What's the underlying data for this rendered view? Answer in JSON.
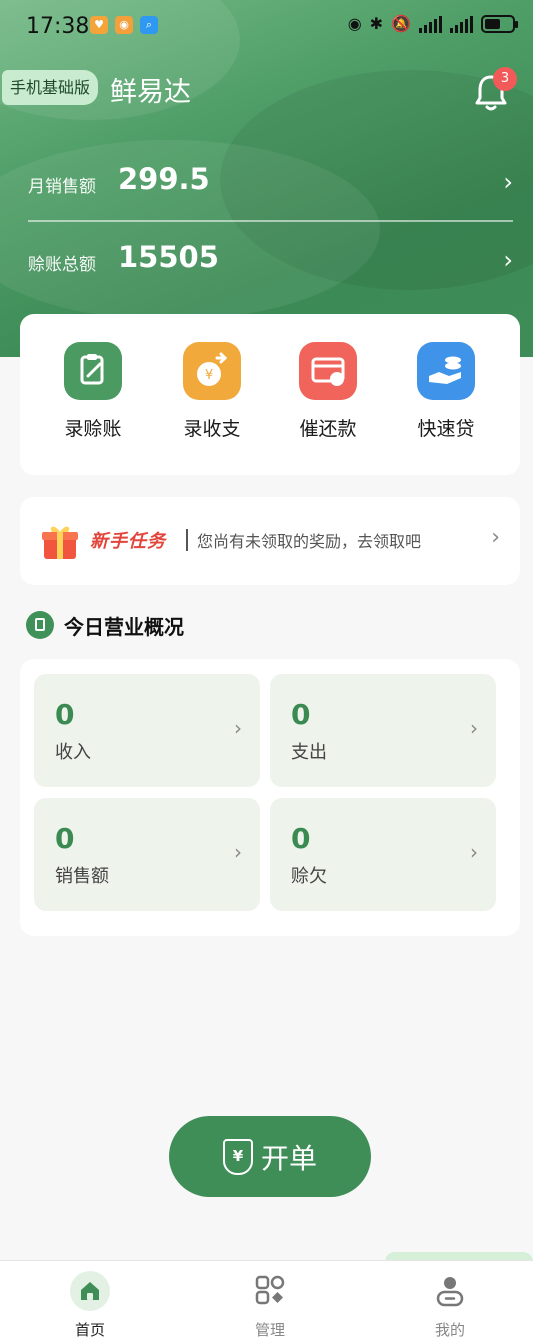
{
  "status_bar": {
    "time": "17:38"
  },
  "header": {
    "plan_badge": "手机基础版",
    "shop_name": "鲜易达",
    "notification_count": "3"
  },
  "stats": [
    {
      "label": "月销售额",
      "value": "299.5"
    },
    {
      "label": "赊账总额",
      "value": "15505"
    }
  ],
  "quick_actions": [
    {
      "label": "录赊账",
      "icon": "clipboard-edit-icon",
      "color": "#4a9a62"
    },
    {
      "label": "录收支",
      "icon": "coin-exchange-icon",
      "color": "#f2a93b"
    },
    {
      "label": "催还款",
      "icon": "card-reminder-icon",
      "color": "#f0645c"
    },
    {
      "label": "快速贷",
      "icon": "hand-coins-icon",
      "color": "#3f93e8"
    }
  ],
  "task_banner": {
    "title": "新手任务",
    "description": "您尚有未领取的奖励，去领取吧"
  },
  "overview": {
    "title": "今日营业概况",
    "tiles": [
      {
        "value": "0",
        "label": "收入"
      },
      {
        "value": "0",
        "label": "支出"
      },
      {
        "value": "0",
        "label": "销售额"
      },
      {
        "value": "0",
        "label": "赊欠"
      }
    ]
  },
  "order_button": {
    "label": "开单"
  },
  "tabs": [
    {
      "label": "首页",
      "icon": "home-icon",
      "active": true
    },
    {
      "label": "管理",
      "icon": "grid-icon",
      "active": false
    },
    {
      "label": "我的",
      "icon": "user-icon",
      "active": false
    }
  ],
  "colors": {
    "brand_green": "#3f8e57",
    "badge_red": "#f25a5a"
  }
}
